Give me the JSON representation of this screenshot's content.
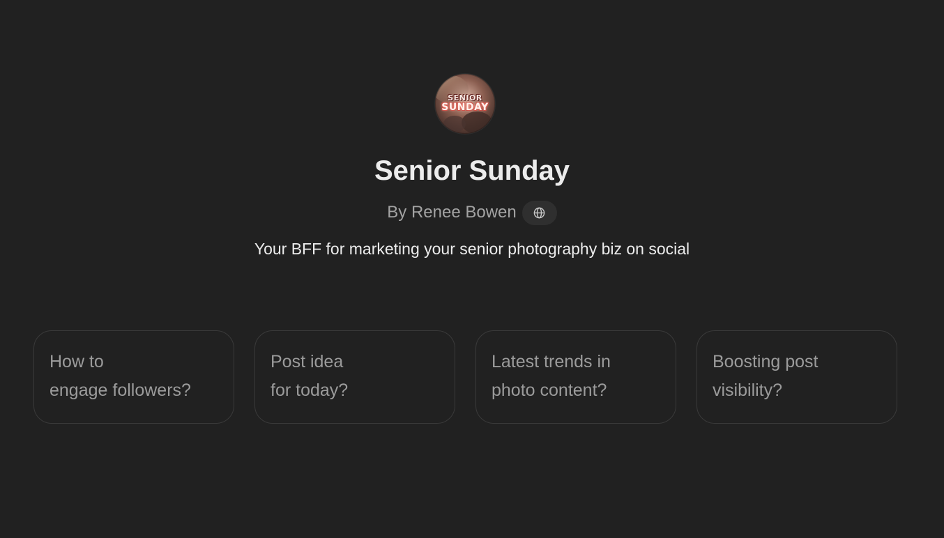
{
  "gpt": {
    "avatar_text_line1": "SENIOR",
    "avatar_text_line2": "SUNDAY",
    "name": "Senior Sunday",
    "author": "By Renee Bowen",
    "author_link_icon": "globe-icon",
    "description": "Your BFF for marketing your senior photography biz on social"
  },
  "conversation_starters": [
    {
      "line1": "How to",
      "line2": "engage followers?"
    },
    {
      "line1": "Post idea",
      "line2": "for today?"
    },
    {
      "line1": "Latest trends in",
      "line2": "photo content?"
    },
    {
      "line1": "Boosting post",
      "line2": "visibility?"
    }
  ],
  "colors": {
    "background": "#212121",
    "title": "#ececec",
    "secondary_text": "#a3a3a3",
    "card_border": "#3a3a3a",
    "card_text": "#9b9b9b"
  }
}
